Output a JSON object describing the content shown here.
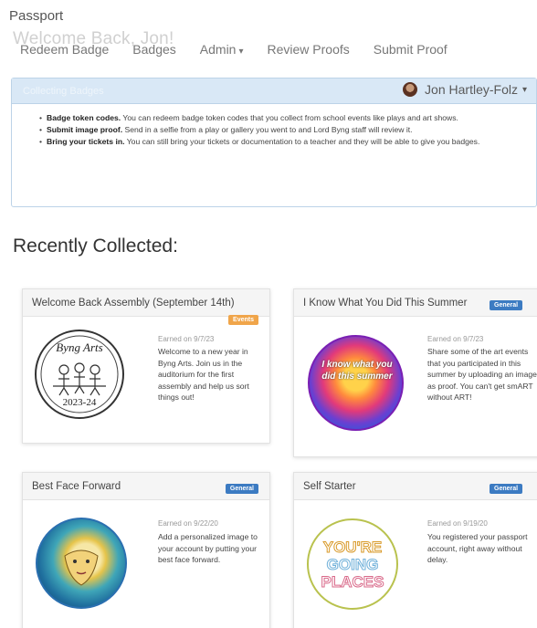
{
  "header": {
    "brand": "Passport",
    "welcome": "Welcome Back, Jon!",
    "nav": [
      {
        "label": "Redeem Badge"
      },
      {
        "label": "Badges"
      },
      {
        "label": "Admin",
        "dropdown": true
      },
      {
        "label": "Review Proofs"
      },
      {
        "label": "Submit Proof"
      }
    ]
  },
  "user": {
    "name": "Jon Hartley-Folz"
  },
  "panel": {
    "title": "Collecting Badges",
    "items": [
      {
        "bold": "Badge token codes.",
        "text": " You can redeem badge token codes that you collect from school events like plays and art shows."
      },
      {
        "bold": "Submit image proof.",
        "text": " Send in a selfie from a play or gallery you went to and Lord Byng staff will review it."
      },
      {
        "bold": "Bring your tickets in.",
        "text": " You can still bring your tickets or documentation to a teacher and they will be able to give you badges."
      }
    ]
  },
  "recent": {
    "title": "Recently Collected:",
    "cards": [
      {
        "title": "Welcome Back Assembly (September 14th)",
        "tag": "Events",
        "earned": "Earned on 9/7/23",
        "description": "Welcome to a new year in Byng Arts. Join us in the auditorium for the first assembly and help us sort things out!",
        "image": {
          "icon": "byng-arts-logo",
          "line1": "Byng Arts",
          "line2": "2023-24"
        }
      },
      {
        "title": "I Know What You Did This Summer",
        "tag": "General",
        "earned": "Earned on 9/7/23",
        "description": "Share some of the art events that you participated in this summer by uploading an image as proof. You can't get smART without ART!",
        "image": {
          "icon": "summer-badge",
          "text": "I know what you did this summer"
        }
      },
      {
        "title": "Best Face Forward",
        "tag": "General",
        "earned": "Earned on 9/22/20",
        "description": "Add a personalized image to your account by putting your best face forward.",
        "image": {
          "icon": "face-portrait-badge"
        }
      },
      {
        "title": "Self Starter",
        "tag": "General",
        "earned": "Earned on 9/19/20",
        "description": "You registered your passport account, right away without delay.",
        "image": {
          "icon": "youre-going-places-badge",
          "line1": "YOU'RE",
          "line2": "GOING",
          "line3": "PLACES"
        }
      }
    ]
  },
  "colors": {
    "events_tag": "#f0a54a",
    "general_tag": "#3c7bc2",
    "panel_head": "#d9e8f6"
  }
}
